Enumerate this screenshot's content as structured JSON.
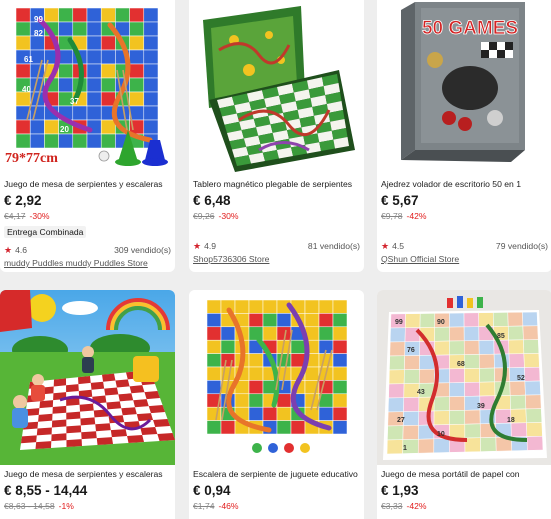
{
  "products": [
    {
      "title": "Juego de mesa de serpientes y escaleras",
      "price": "€ 2,92",
      "original_price": "€4,17",
      "discount": "-30%",
      "badge": "Entrega Combinada",
      "rating": "4.6",
      "sold": "309 vendido(s)",
      "store": "muddy Puddles muddy Puddles Store",
      "image_caption": "79*77cm",
      "board_numbers": [
        "99",
        "82",
        "61",
        "40",
        "37",
        "20"
      ]
    },
    {
      "title": "Tablero magnético plegable de serpientes",
      "price": "€ 6,48",
      "original_price": "€9,26",
      "discount": "-30%",
      "rating": "4.9",
      "sold": "81 vendido(s)",
      "store": "Shop5736306 Store"
    },
    {
      "title": "Ajedrez volador de escritorio 50 en 1",
      "price": "€ 5,67",
      "original_price": "€9,78",
      "discount": "-42%",
      "rating": "4.5",
      "sold": "79 vendido(s)",
      "store": "QShun Official Store",
      "box_text": "50 GAMES"
    },
    {
      "title": "Juego de mesa de serpientes y escaleras",
      "price": "€ 8,55 - 14,44",
      "original_price": "€8,63 - 14,58",
      "discount": "-1%"
    },
    {
      "title": "Escalera de serpiente de juguete educativo",
      "price": "€ 0,94",
      "original_price": "€1,74",
      "discount": "-46%"
    },
    {
      "title": "Juego de mesa portátil de papel con",
      "price": "€ 1,93",
      "original_price": "€3,33",
      "discount": "-42%",
      "board_numbers": [
        "99",
        "90",
        "85",
        "76",
        "68",
        "52",
        "43",
        "39",
        "27",
        "18",
        "10",
        "1"
      ]
    }
  ],
  "colors": {
    "discount": "#e11b1b",
    "star": "#d3232d",
    "page_bg": "#eeeeee"
  }
}
